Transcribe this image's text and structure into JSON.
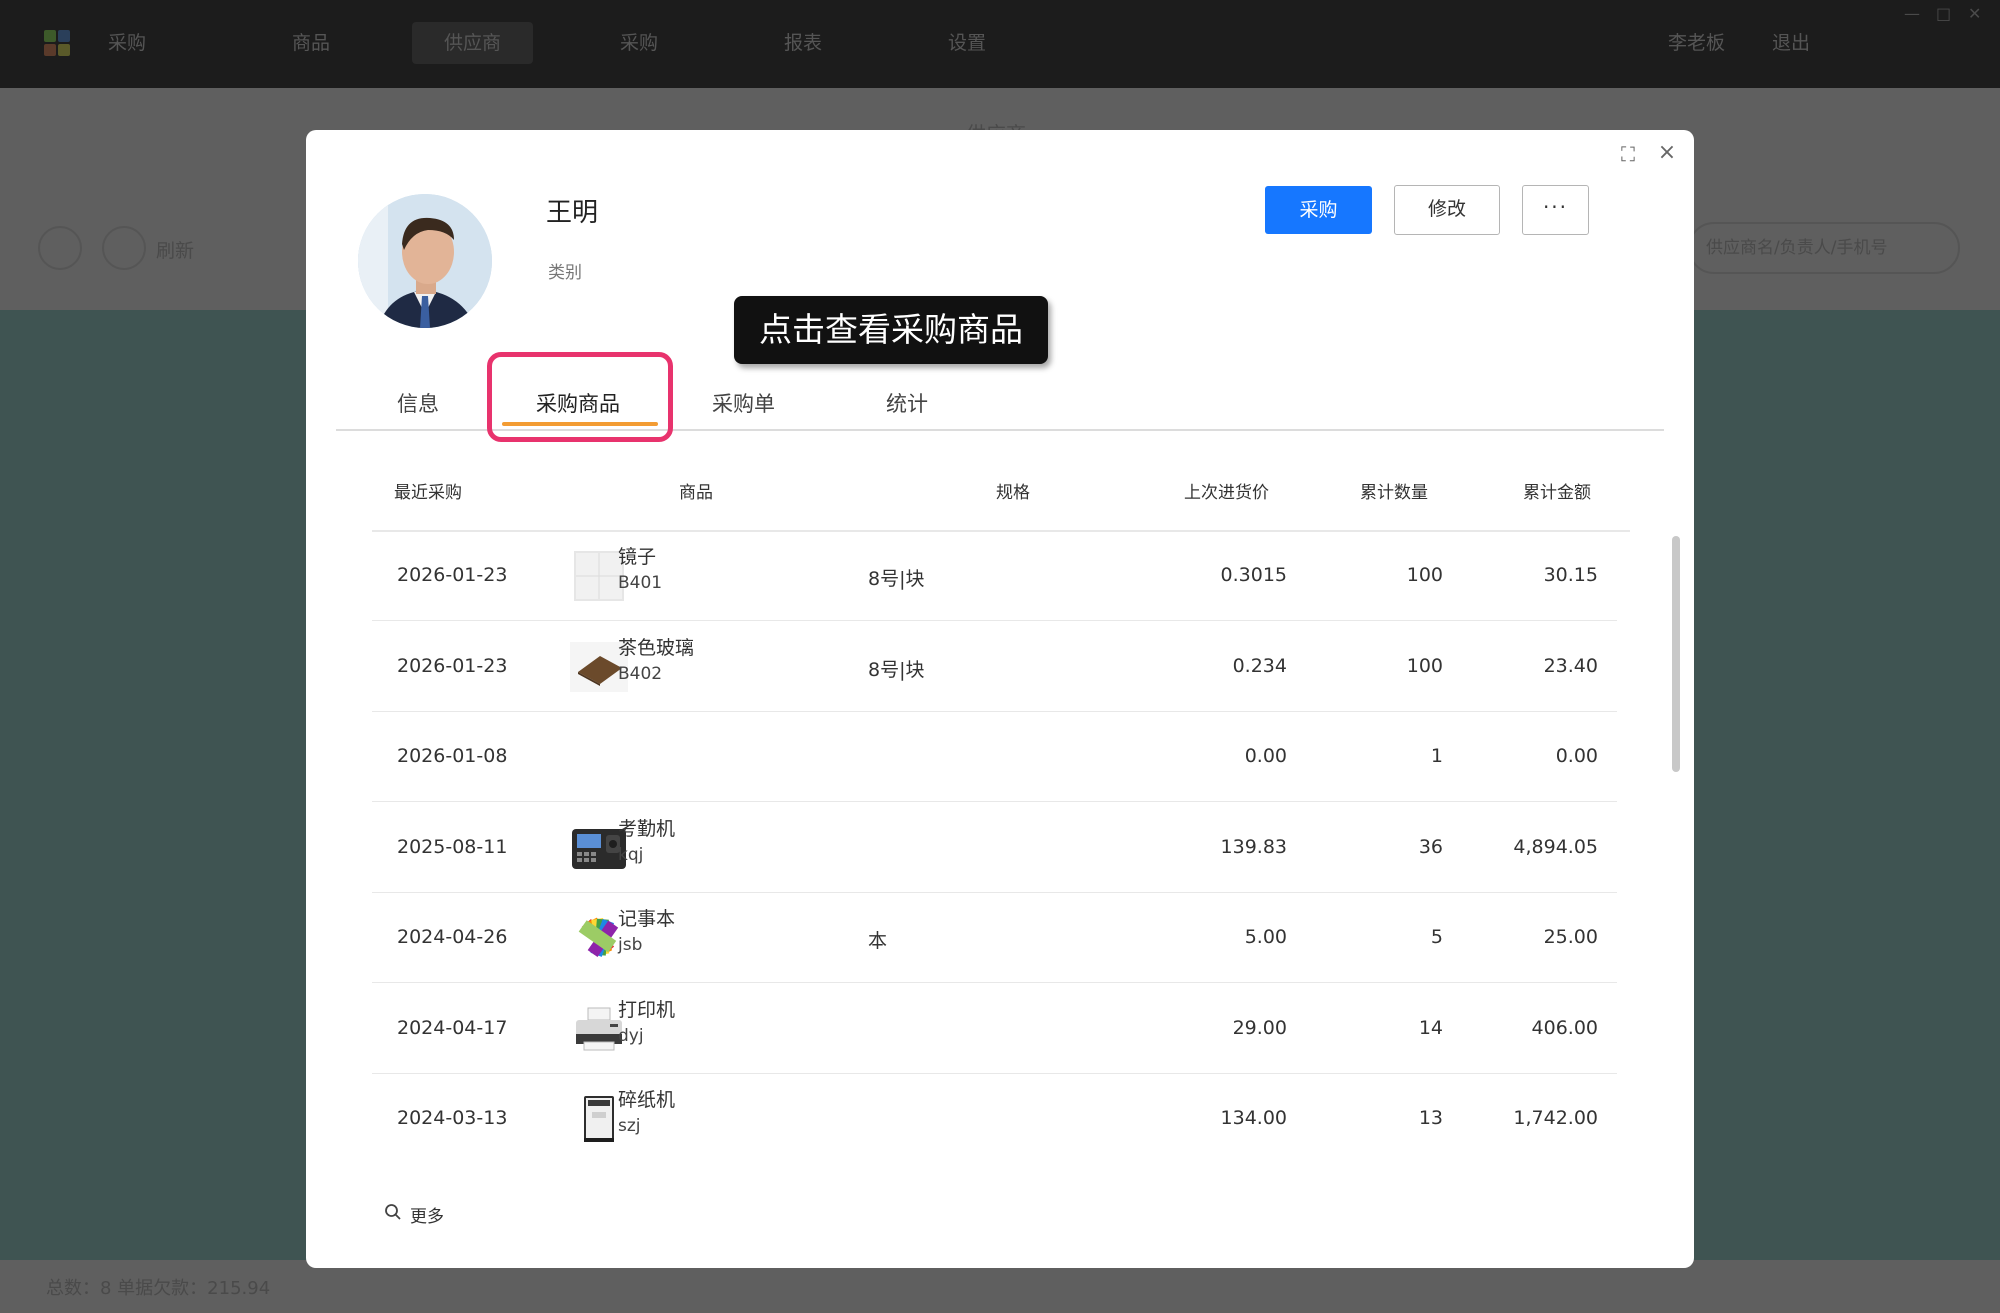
{
  "app": {
    "nav": [
      "采购",
      "商品",
      "供应商",
      "采购",
      "报表",
      "设置"
    ],
    "user": "李老板",
    "logout": "退出",
    "header_title": "供应商",
    "refresh_label": "刷新",
    "search_placeholder": "供应商名/负责人/手机号",
    "footer_text": "总数：8    单据欠款：215.94",
    "window_controls": [
      "—",
      "□",
      "✕"
    ]
  },
  "modal": {
    "expand_icon": "expand-icon",
    "close_icon": "close-icon",
    "close_glyph": "×",
    "expand_glyph": "⛶",
    "supplier": {
      "name": "王明",
      "category_label": "类别"
    },
    "buttons": {
      "purchase": "采购",
      "edit": "修改",
      "more": "···"
    },
    "tooltip": "点击查看采购商品",
    "tabs": [
      "信息",
      "采购商品",
      "采购单",
      "统计"
    ],
    "active_tab": "采购商品",
    "table": {
      "headers": {
        "recent": "最近采购",
        "product": "商品",
        "spec": "规格",
        "last_price": "上次进货价",
        "total_qty": "累计数量",
        "total_amount": "累计金额"
      },
      "rows": [
        {
          "date": "2026-01-23",
          "thumb": "mirror",
          "name": "镜子",
          "code": "B401",
          "spec": "8号|块",
          "price": "0.3015",
          "qty": "100",
          "amount": "30.15"
        },
        {
          "date": "2026-01-23",
          "thumb": "glass",
          "name": "茶色玻璃",
          "code": "B402",
          "spec": "8号|块",
          "price": "0.234",
          "qty": "100",
          "amount": "23.40"
        },
        {
          "date": "2026-01-08",
          "thumb": "",
          "name": "",
          "code": "",
          "spec": "",
          "price": "0.00",
          "qty": "1",
          "amount": "0.00"
        },
        {
          "date": "2025-08-11",
          "thumb": "attendance",
          "name": "考勤机",
          "code": "kqj",
          "spec": "",
          "price": "139.83",
          "qty": "36",
          "amount": "4,894.05"
        },
        {
          "date": "2024-04-26",
          "thumb": "notebook",
          "name": "记事本",
          "code": "jsb",
          "spec": "本",
          "price": "5.00",
          "qty": "5",
          "amount": "25.00"
        },
        {
          "date": "2024-04-17",
          "thumb": "printer",
          "name": "打印机",
          "code": "dyj",
          "spec": "",
          "price": "29.00",
          "qty": "14",
          "amount": "406.00"
        },
        {
          "date": "2024-03-13",
          "thumb": "shredder",
          "name": "碎纸机",
          "code": "szj",
          "spec": "",
          "price": "134.00",
          "qty": "13",
          "amount": "1,742.00"
        }
      ]
    },
    "more_label": "更多"
  },
  "colors": {
    "primary": "#1677ff",
    "tab_underline": "#f39c33",
    "highlight": "#e8336d"
  }
}
